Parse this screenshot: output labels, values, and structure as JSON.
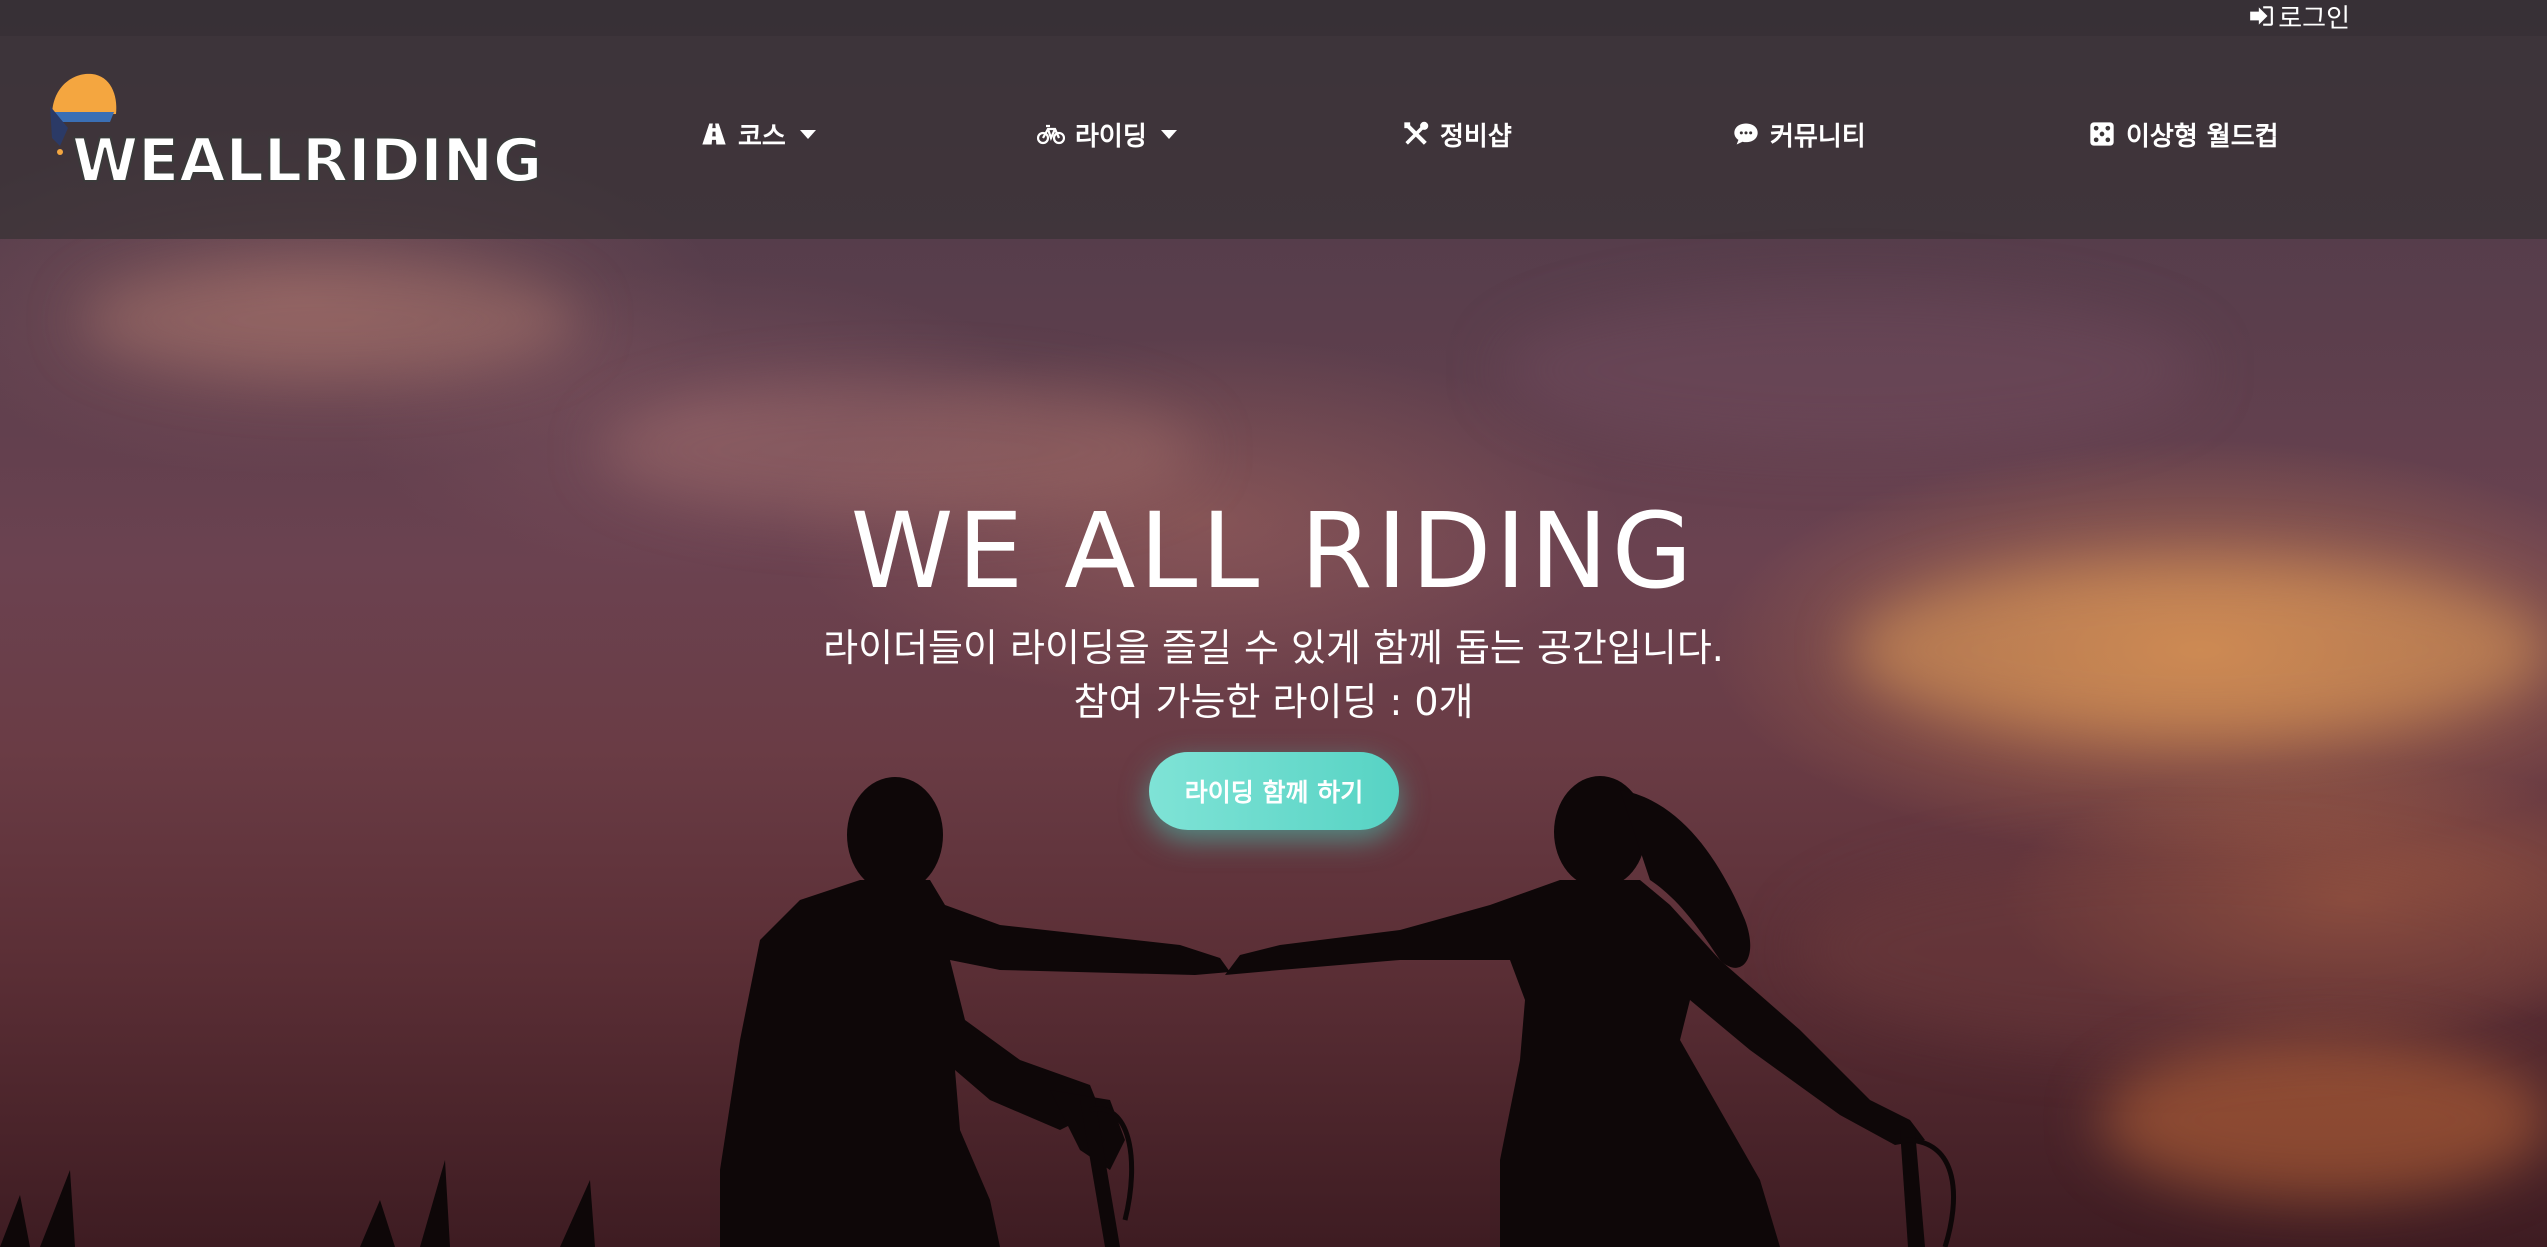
{
  "topbar": {
    "login_label": "로그인",
    "login_icon": "sign-in-icon"
  },
  "brand": {
    "logo_text": "WEALLRIDING",
    "logo_icon": "helmet-icon"
  },
  "nav": {
    "items": [
      {
        "label": "코스",
        "icon": "road-icon",
        "dropdown": true
      },
      {
        "label": "라이딩",
        "icon": "bicycle-icon",
        "dropdown": true
      },
      {
        "label": "정비샵",
        "icon": "tools-icon",
        "dropdown": false
      },
      {
        "label": "커뮤니티",
        "icon": "comment-icon",
        "dropdown": false
      },
      {
        "label": "이상형 월드컵",
        "icon": "dice-icon",
        "dropdown": false
      }
    ]
  },
  "hero": {
    "title": "WE ALL RIDING",
    "subtitle": "라이더들이 라이딩을 즐길 수 있게 함께 돕는 공간입니다.",
    "available_rides": "참여 가능한 라이딩 : 0개",
    "cta_label": "라이딩 함께 하기"
  },
  "colors": {
    "cta_start": "#7fe3d6",
    "cta_end": "#57d3c4",
    "navbar_bg": "#373234",
    "text": "#ffffff"
  }
}
